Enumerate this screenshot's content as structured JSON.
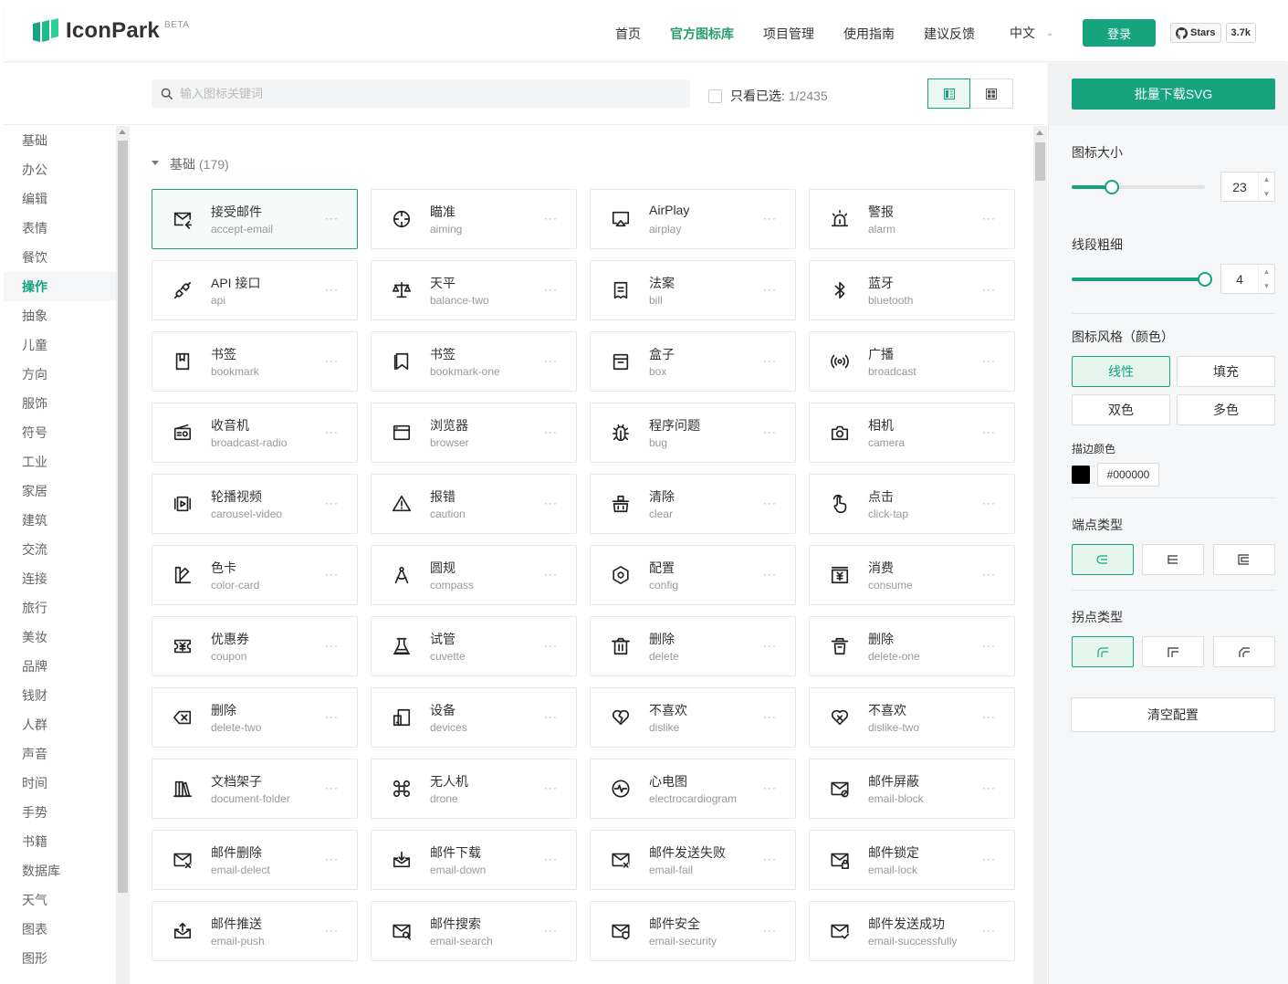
{
  "header": {
    "logo_text": "IconPark",
    "beta": "BETA",
    "nav": [
      {
        "label": "首页",
        "active": false
      },
      {
        "label": "官方图标库",
        "active": true
      },
      {
        "label": "项目管理",
        "active": false
      },
      {
        "label": "使用指南",
        "active": false
      },
      {
        "label": "建议反馈",
        "active": false
      }
    ],
    "language": "中文",
    "login_label": "登录",
    "github_label": "Stars",
    "github_count": "3.7k"
  },
  "toolbar": {
    "search_placeholder": "输入图标关键词",
    "only_selected_label": "只看已选:",
    "only_selected_count": "1/2435"
  },
  "sidebar": {
    "categories": [
      {
        "label": "基础",
        "active": false
      },
      {
        "label": "办公",
        "active": false
      },
      {
        "label": "编辑",
        "active": false
      },
      {
        "label": "表情",
        "active": false
      },
      {
        "label": "餐饮",
        "active": false
      },
      {
        "label": "操作",
        "active": true
      },
      {
        "label": "抽象",
        "active": false
      },
      {
        "label": "儿童",
        "active": false
      },
      {
        "label": "方向",
        "active": false
      },
      {
        "label": "服饰",
        "active": false
      },
      {
        "label": "符号",
        "active": false
      },
      {
        "label": "工业",
        "active": false
      },
      {
        "label": "家居",
        "active": false
      },
      {
        "label": "建筑",
        "active": false
      },
      {
        "label": "交流",
        "active": false
      },
      {
        "label": "连接",
        "active": false
      },
      {
        "label": "旅行",
        "active": false
      },
      {
        "label": "美妆",
        "active": false
      },
      {
        "label": "品牌",
        "active": false
      },
      {
        "label": "钱财",
        "active": false
      },
      {
        "label": "人群",
        "active": false
      },
      {
        "label": "声音",
        "active": false
      },
      {
        "label": "时间",
        "active": false
      },
      {
        "label": "手势",
        "active": false
      },
      {
        "label": "书籍",
        "active": false
      },
      {
        "label": "数据库",
        "active": false
      },
      {
        "label": "天气",
        "active": false
      },
      {
        "label": "图表",
        "active": false
      },
      {
        "label": "图形",
        "active": false
      }
    ]
  },
  "main": {
    "section_title": "基础",
    "section_count": "(179)",
    "more_label": "···",
    "icons": [
      {
        "cn": "接受邮件",
        "en": "accept-email",
        "icon": "mail-in-icon",
        "selected": true
      },
      {
        "cn": "瞄准",
        "en": "aiming",
        "icon": "aiming-icon",
        "selected": false
      },
      {
        "cn": "AirPlay",
        "en": "airplay",
        "icon": "airplay-icon",
        "selected": false
      },
      {
        "cn": "警报",
        "en": "alarm",
        "icon": "alarm-icon",
        "selected": false
      },
      {
        "cn": "API 接口",
        "en": "api",
        "icon": "api-icon",
        "selected": false
      },
      {
        "cn": "天平",
        "en": "balance-two",
        "icon": "balance-icon",
        "selected": false
      },
      {
        "cn": "法案",
        "en": "bill",
        "icon": "bill-icon",
        "selected": false
      },
      {
        "cn": "蓝牙",
        "en": "bluetooth",
        "icon": "bluetooth-icon",
        "selected": false
      },
      {
        "cn": "书签",
        "en": "bookmark",
        "icon": "bookmark-icon",
        "selected": false
      },
      {
        "cn": "书签",
        "en": "bookmark-one",
        "icon": "bookmark-one-icon",
        "selected": false
      },
      {
        "cn": "盒子",
        "en": "box",
        "icon": "box-icon",
        "selected": false
      },
      {
        "cn": "广播",
        "en": "broadcast",
        "icon": "broadcast-icon",
        "selected": false
      },
      {
        "cn": "收音机",
        "en": "broadcast-radio",
        "icon": "radio-icon",
        "selected": false
      },
      {
        "cn": "浏览器",
        "en": "browser",
        "icon": "browser-icon",
        "selected": false
      },
      {
        "cn": "程序问题",
        "en": "bug",
        "icon": "bug-icon",
        "selected": false
      },
      {
        "cn": "相机",
        "en": "camera",
        "icon": "camera-icon",
        "selected": false
      },
      {
        "cn": "轮播视频",
        "en": "carousel-video",
        "icon": "carousel-video-icon",
        "selected": false
      },
      {
        "cn": "报错",
        "en": "caution",
        "icon": "caution-icon",
        "selected": false
      },
      {
        "cn": "清除",
        "en": "clear",
        "icon": "clear-icon",
        "selected": false
      },
      {
        "cn": "点击",
        "en": "click-tap",
        "icon": "click-tap-icon",
        "selected": false
      },
      {
        "cn": "色卡",
        "en": "color-card",
        "icon": "color-card-icon",
        "selected": false
      },
      {
        "cn": "圆规",
        "en": "compass",
        "icon": "compass-icon",
        "selected": false
      },
      {
        "cn": "配置",
        "en": "config",
        "icon": "config-icon",
        "selected": false
      },
      {
        "cn": "消费",
        "en": "consume",
        "icon": "consume-icon",
        "selected": false
      },
      {
        "cn": "优惠券",
        "en": "coupon",
        "icon": "coupon-icon",
        "selected": false
      },
      {
        "cn": "试管",
        "en": "cuvette",
        "icon": "cuvette-icon",
        "selected": false
      },
      {
        "cn": "删除",
        "en": "delete",
        "icon": "delete-icon",
        "selected": false
      },
      {
        "cn": "删除",
        "en": "delete-one",
        "icon": "delete-one-icon",
        "selected": false
      },
      {
        "cn": "删除",
        "en": "delete-two",
        "icon": "delete-two-icon",
        "selected": false
      },
      {
        "cn": "设备",
        "en": "devices",
        "icon": "devices-icon",
        "selected": false
      },
      {
        "cn": "不喜欢",
        "en": "dislike",
        "icon": "dislike-icon",
        "selected": false
      },
      {
        "cn": "不喜欢",
        "en": "dislike-two",
        "icon": "dislike-two-icon",
        "selected": false
      },
      {
        "cn": "文档架子",
        "en": "document-folder",
        "icon": "document-folder-icon",
        "selected": false
      },
      {
        "cn": "无人机",
        "en": "drone",
        "icon": "drone-icon",
        "selected": false
      },
      {
        "cn": "心电图",
        "en": "electrocardiogram",
        "icon": "ecg-icon",
        "selected": false
      },
      {
        "cn": "邮件屏蔽",
        "en": "email-block",
        "icon": "email-block-icon",
        "selected": false
      },
      {
        "cn": "邮件删除",
        "en": "email-delect",
        "icon": "email-delete-icon",
        "selected": false
      },
      {
        "cn": "邮件下载",
        "en": "email-down",
        "icon": "email-down-icon",
        "selected": false
      },
      {
        "cn": "邮件发送失败",
        "en": "email-fail",
        "icon": "email-fail-icon",
        "selected": false
      },
      {
        "cn": "邮件锁定",
        "en": "email-lock",
        "icon": "email-lock-icon",
        "selected": false
      },
      {
        "cn": "邮件推送",
        "en": "email-push",
        "icon": "email-push-icon",
        "selected": false
      },
      {
        "cn": "邮件搜索",
        "en": "email-search",
        "icon": "email-search-icon",
        "selected": false
      },
      {
        "cn": "邮件安全",
        "en": "email-security",
        "icon": "email-security-icon",
        "selected": false
      },
      {
        "cn": "邮件发送成功",
        "en": "email-successfully",
        "icon": "email-success-icon",
        "selected": false
      }
    ]
  },
  "panel": {
    "download_label": "批量下载SVG",
    "size_label": "图标大小",
    "size_value": "23",
    "size_fraction": 0.3,
    "stroke_label": "线段粗细",
    "stroke_value": "4",
    "stroke_fraction": 1.0,
    "style_label": "图标风格（颜色）",
    "styles": [
      {
        "label": "线性",
        "active": true
      },
      {
        "label": "填充",
        "active": false
      },
      {
        "label": "双色",
        "active": false
      },
      {
        "label": "多色",
        "active": false
      }
    ],
    "stroke_color_label": "描边颜色",
    "stroke_color": "#000000",
    "cap_label": "端点类型",
    "join_label": "拐点类型",
    "clear_label": "清空配置"
  },
  "colors": {
    "accent": "#16a37f"
  }
}
